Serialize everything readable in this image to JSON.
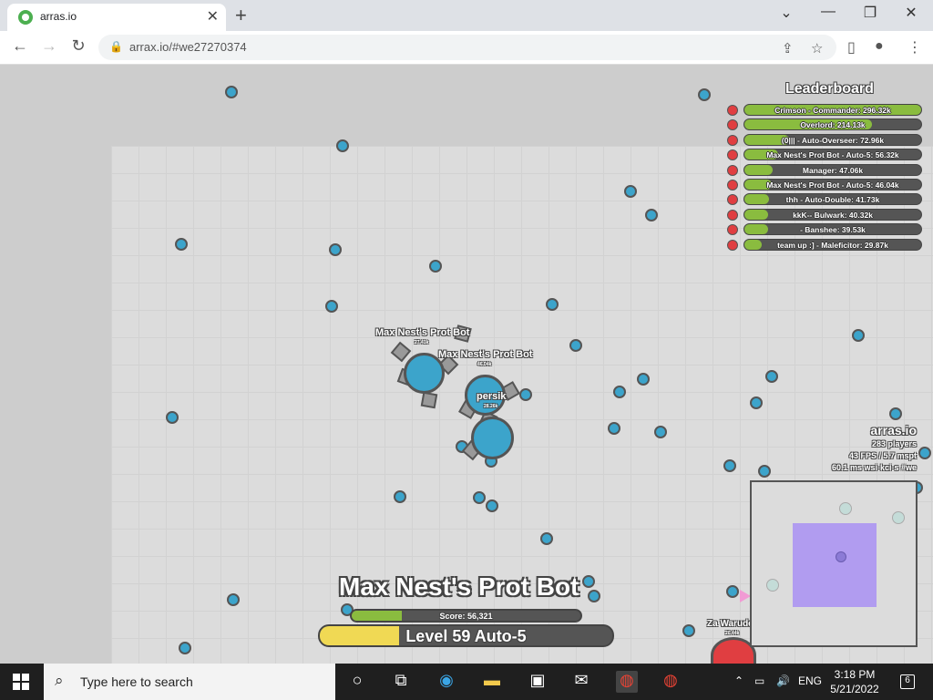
{
  "browser": {
    "tab_title": "arras.io",
    "new_tab": "+",
    "tab_close": "✕",
    "url": "arrax.io/#we27270374",
    "back": "←",
    "forward": "→",
    "reload": "↻",
    "win_min": "⌄",
    "win_min2": "—",
    "win_max": "❐",
    "win_close": "✕"
  },
  "leaderboard": {
    "title": "Leaderboard",
    "rows": [
      {
        "text": "Crimson - Commander: 296.32k",
        "fill": 1.0
      },
      {
        "text": "Overlord: 214.13k",
        "fill": 0.72
      },
      {
        "text": "(0||| - Auto-Overseer: 72.96k",
        "fill": 0.25
      },
      {
        "text": "Max Nest's Prot Bot - Auto-5: 56.32k",
        "fill": 0.19
      },
      {
        "text": "Manager: 47.06k",
        "fill": 0.16
      },
      {
        "text": "Max Nest's Prot Bot - Auto-5: 46.04k",
        "fill": 0.155
      },
      {
        "text": "thh - Auto-Double: 41.73k",
        "fill": 0.14
      },
      {
        "text": "kkK-- Bulwark: 40.32k",
        "fill": 0.136
      },
      {
        "text": "- Banshee: 39.53k",
        "fill": 0.133
      },
      {
        "text": "team up :] - Maleficitor: 29.87k",
        "fill": 0.1
      }
    ]
  },
  "server_info": {
    "name": "arras.io",
    "players": "283 players",
    "fps": "43 FPS / 5.7 mspt",
    "ping": "60.1 ms  wsi-kci-s #we"
  },
  "tanks": [
    {
      "name": "Max Nest's Prot Bot",
      "score": "27.41k"
    },
    {
      "name": "Max Nest's Prot Bot",
      "score": "46.04k"
    },
    {
      "name": "persik",
      "score": "28.26k"
    },
    {
      "name": "Za Warudo",
      "score": "20.44k"
    }
  ],
  "player": {
    "name": "Max Nest's Prot Bot",
    "score_text": "Score: 56,321",
    "score_fill": 0.22,
    "level_text": "Level 59 Auto-5",
    "level_fill": 0.27
  },
  "colors": {
    "accent_green": "#8abc3f",
    "level_yellow": "#f0d954",
    "tank_blue": "#3ca4cb",
    "enemy_red": "#e03e41"
  },
  "taskbar": {
    "search_placeholder": "Type here to search",
    "lang": "ENG",
    "time": "3:18 PM",
    "date": "5/21/2022",
    "notifications": "6"
  }
}
